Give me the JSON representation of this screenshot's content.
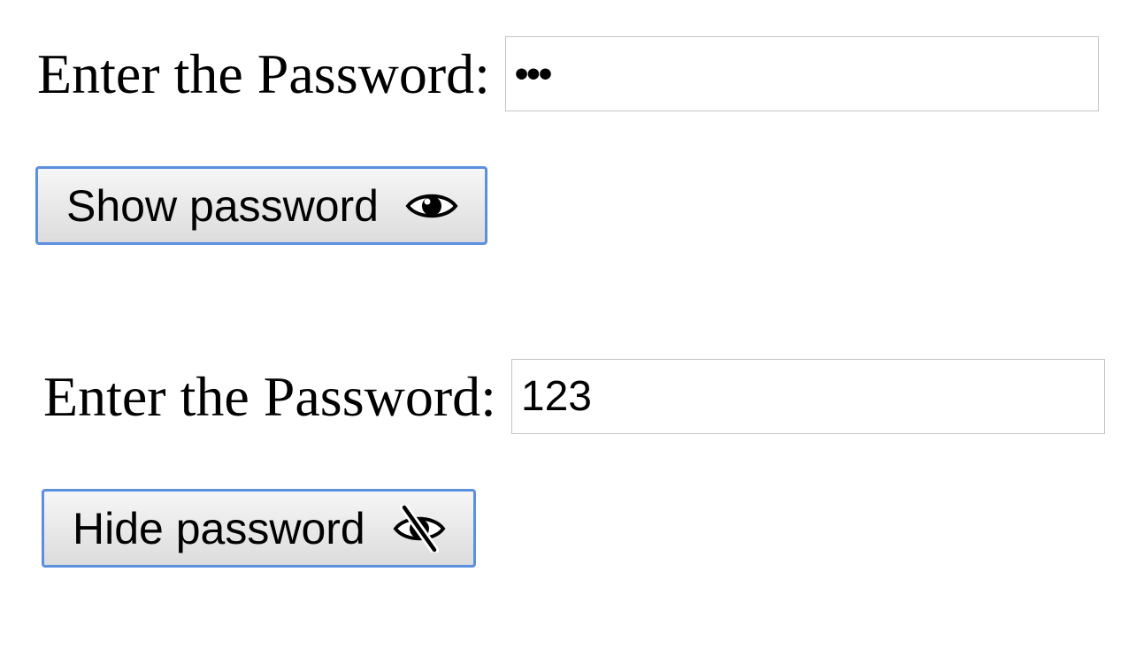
{
  "forms": [
    {
      "label": "Enter the Password:",
      "value": "•••",
      "masked": true,
      "button_label": "Show password",
      "button_icon": "eye-icon"
    },
    {
      "label": "Enter the Password:",
      "value": "123",
      "masked": false,
      "button_label": "Hide password",
      "button_icon": "eye-slash-icon"
    }
  ],
  "colors": {
    "button_border": "#5b8fe0",
    "input_border": "#c4c4c4"
  }
}
